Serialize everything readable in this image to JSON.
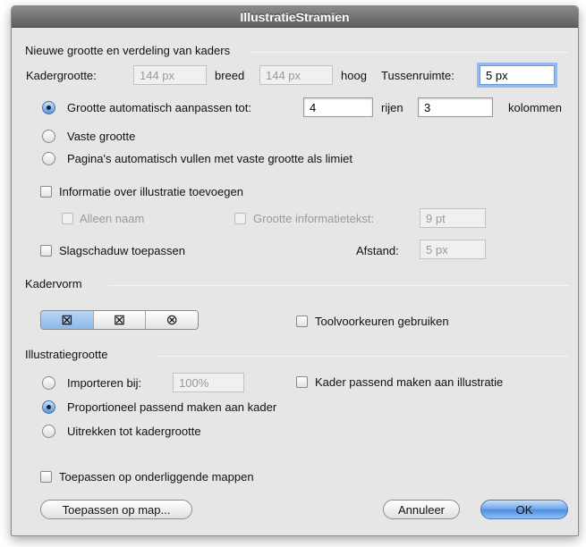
{
  "window": {
    "title": "IllustratieStramien"
  },
  "section_new": {
    "heading": "Nieuwe grootte en verdeling van kaders",
    "frame_size_label": "Kadergrootte:",
    "width_value": "144 px",
    "width_label": "breed",
    "height_value": "144 px",
    "height_label": "hoog",
    "spacing_label": "Tussenruimte:",
    "spacing_value": "5 px",
    "auto_size_label": "Grootte automatisch aanpassen tot:",
    "rows_value": "4",
    "rows_label": "rijen",
    "cols_value": "3",
    "cols_label": "kolommen",
    "fixed_size_label": "Vaste grootte",
    "auto_fill_label": "Pagina's automatisch vullen met vaste grootte als limiet",
    "selected_mode": "auto_size"
  },
  "info": {
    "add_info_label": "Informatie over illustratie toevoegen",
    "add_info_checked": false,
    "name_only_label": "Alleen naam",
    "info_text_size_label": "Grootte informatietekst:",
    "info_text_size_value": "9 pt",
    "drop_shadow_label": "Slagschaduw toepassen",
    "distance_label": "Afstand:",
    "distance_value": "5 px"
  },
  "frame_shape": {
    "heading": "Kadervorm",
    "shapes": [
      {
        "glyph": "⊠",
        "name": "rectangle"
      },
      {
        "glyph": "⊠",
        "name": "rounded"
      },
      {
        "glyph": "⊗",
        "name": "ellipse"
      }
    ],
    "selected_index": 0,
    "tool_prefs_label": "Toolvoorkeuren gebruiken"
  },
  "illustration_size": {
    "heading": "Illustratiegrootte",
    "import_at_label": "Importeren bij:",
    "import_value": "100%",
    "fit_frame_label": "Kader passend maken aan illustratie",
    "proportional_label": "Proportioneel passend maken aan kader",
    "stretch_label": "Uitrekken tot kadergrootte",
    "selected_mode": "proportional"
  },
  "footer": {
    "subfolders_label": "Toepassen op onderliggende mappen",
    "apply_folder_label": "Toepassen op map...",
    "cancel_label": "Annuleer",
    "ok_label": "OK"
  },
  "colors": {
    "accent": "#5d95da",
    "window_bg": "#e6e6e6",
    "title_bg": "#6e6e6e"
  }
}
